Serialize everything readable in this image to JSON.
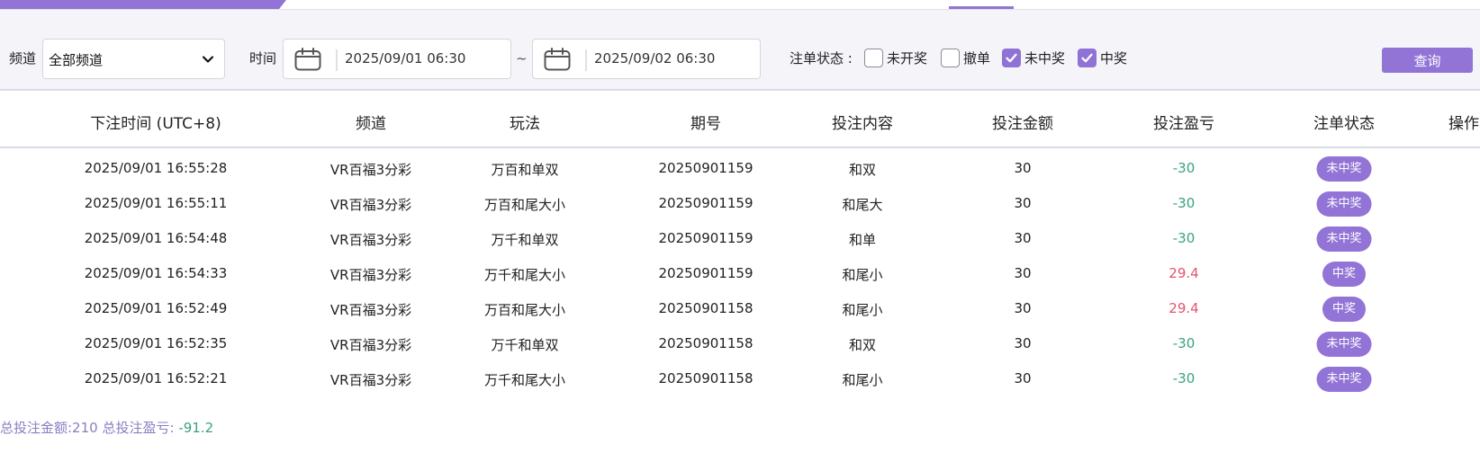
{
  "filters": {
    "channel_label": "频道",
    "channel_value": "全部频道",
    "time_label": "时间",
    "start_date": "2025/09/01 06:30",
    "range_separator": "~",
    "end_date": "2025/09/02 06:30",
    "status_label": "注单状态 :",
    "statuses": [
      {
        "label": "未开奖",
        "checked": false
      },
      {
        "label": "撤单",
        "checked": false
      },
      {
        "label": "未中奖",
        "checked": true
      },
      {
        "label": "中奖",
        "checked": true
      }
    ],
    "query_label": "查询"
  },
  "table": {
    "headers": [
      "下注时间 (UTC+8)",
      "频道",
      "玩法",
      "期号",
      "投注内容",
      "投注金额",
      "投注盈亏",
      "注单状态",
      "操作"
    ],
    "rows": [
      {
        "time": "2025/09/01 16:55:28",
        "channel": "VR百福3分彩",
        "play": "万百和单双",
        "issue": "20250901159",
        "content": "和双",
        "amount": "30",
        "pl": "-30",
        "status": "未中奖"
      },
      {
        "time": "2025/09/01 16:55:11",
        "channel": "VR百福3分彩",
        "play": "万百和尾大小",
        "issue": "20250901159",
        "content": "和尾大",
        "amount": "30",
        "pl": "-30",
        "status": "未中奖"
      },
      {
        "time": "2025/09/01 16:54:48",
        "channel": "VR百福3分彩",
        "play": "万千和单双",
        "issue": "20250901159",
        "content": "和单",
        "amount": "30",
        "pl": "-30",
        "status": "未中奖"
      },
      {
        "time": "2025/09/01 16:54:33",
        "channel": "VR百福3分彩",
        "play": "万千和尾大小",
        "issue": "20250901159",
        "content": "和尾小",
        "amount": "30",
        "pl": "29.4",
        "status": "中奖"
      },
      {
        "time": "2025/09/01 16:52:49",
        "channel": "VR百福3分彩",
        "play": "万百和尾大小",
        "issue": "20250901158",
        "content": "和尾小",
        "amount": "30",
        "pl": "29.4",
        "status": "中奖"
      },
      {
        "time": "2025/09/01 16:52:35",
        "channel": "VR百福3分彩",
        "play": "万千和单双",
        "issue": "20250901158",
        "content": "和双",
        "amount": "30",
        "pl": "-30",
        "status": "未中奖"
      },
      {
        "time": "2025/09/01 16:52:21",
        "channel": "VR百福3分彩",
        "play": "万千和尾大小",
        "issue": "20250901158",
        "content": "和尾小",
        "amount": "30",
        "pl": "-30",
        "status": "未中奖"
      }
    ]
  },
  "summary": {
    "total_amount_text": "总投注金额:210 总投注盈亏:",
    "total_pl": "-91.2"
  },
  "colors": {
    "accent": "#9274d6",
    "loss": "#3aa37a",
    "win": "#e2546e"
  }
}
